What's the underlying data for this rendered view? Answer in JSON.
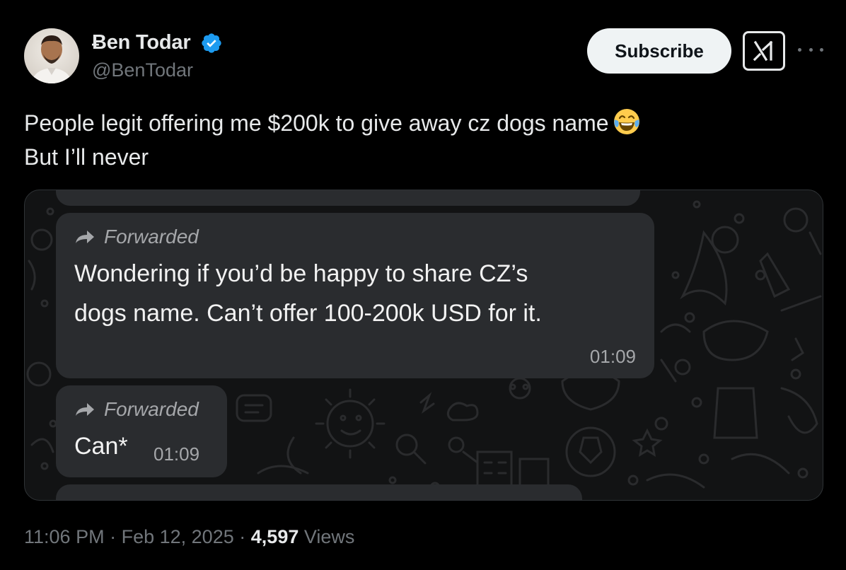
{
  "author": {
    "display_name": "Ƀen Todar",
    "handle": "@BenTodar",
    "verified": true,
    "verified_color": "#1d9bf0"
  },
  "actions": {
    "subscribe_label": "Subscribe",
    "grok_icon": "grok-icon",
    "more_icon": "more-icon"
  },
  "tweet": {
    "line1": "People legit offering me $200k to give away cz dogs name",
    "line1_emoji": "face-with-tears-of-joy-emoji",
    "line2": "But I’ll never"
  },
  "media": {
    "messages": [
      {
        "forwarded_label": "Forwarded",
        "text_line1": "Wondering if you’d be happy to share CZ’s",
        "text_line2": "dogs name. Can’t offer 100-200k USD for it.",
        "time": "01:09"
      },
      {
        "forwarded_label": "Forwarded",
        "text": "Can*",
        "time": "01:09"
      }
    ]
  },
  "meta": {
    "time": "11:06 PM",
    "date": "Feb 12, 2025",
    "views_count": "4,597",
    "views_label": "Views",
    "separator": "·"
  }
}
